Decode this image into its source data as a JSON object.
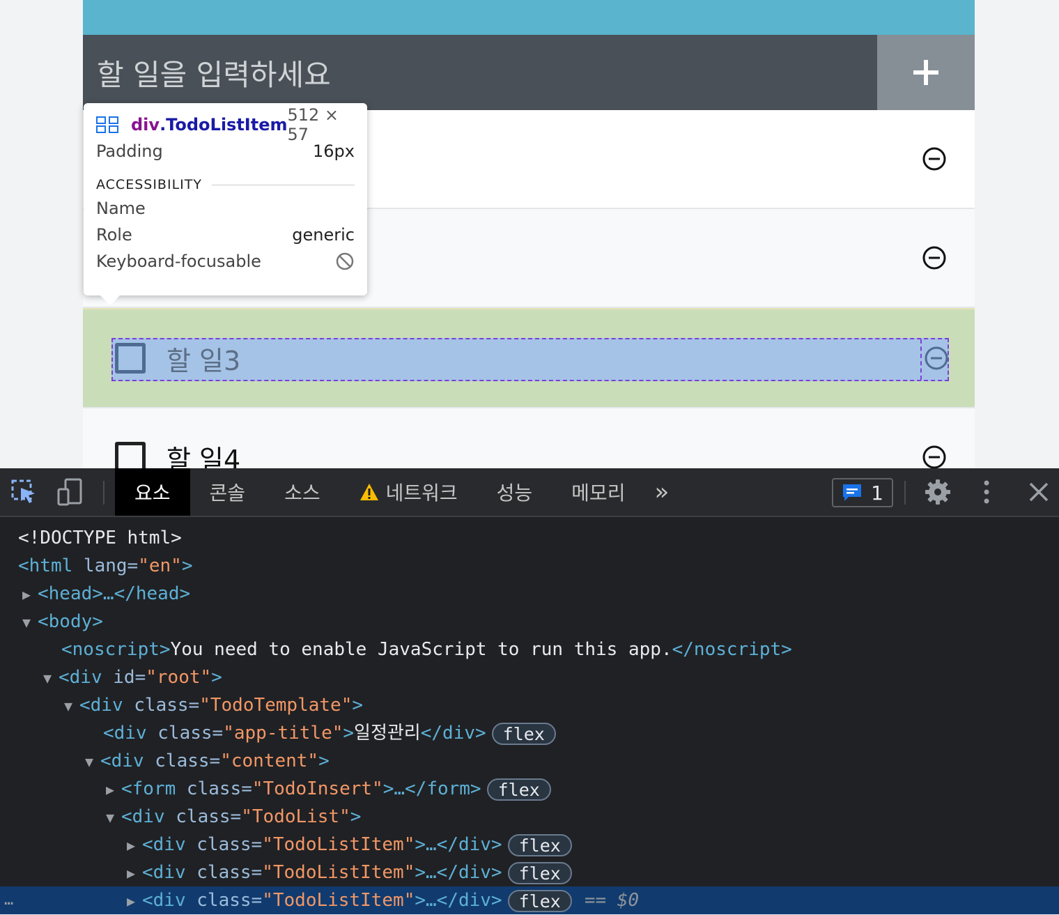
{
  "app": {
    "insert_placeholder": "할 일을 입력하세요",
    "todos": [
      {
        "text": ""
      },
      {
        "text": ""
      },
      {
        "text": "할 일3"
      },
      {
        "text": "할 일4"
      }
    ]
  },
  "tooltip": {
    "selector_tag": "div",
    "selector_class": ".TodoListItem",
    "size": "512 × 57",
    "padding_label": "Padding",
    "padding_value": "16px",
    "section": "ACCESSIBILITY",
    "name_label": "Name",
    "role_label": "Role",
    "role_value": "generic",
    "focusable_label": "Keyboard-focusable"
  },
  "devtools": {
    "tabs": [
      "요소",
      "콘솔",
      "소스",
      "네트워크",
      "성능",
      "메모리"
    ],
    "more_tabs": "»",
    "message_count": "1",
    "dom_lines": {
      "doctype": "<!DOCTYPE html>",
      "html_open": "<html",
      "html_attr": " lang=",
      "html_val": "\"en\"",
      "html_close": ">",
      "head": "<head>…</head>",
      "body": "<body>",
      "noscript_open": "<noscript>",
      "noscript_text": "You need to enable JavaScript to run this app.",
      "noscript_close": "</noscript>",
      "div_open": "<div",
      "id_attr": " id=",
      "root_val": "\"root\"",
      "class_attr": " class=",
      "todo_template": "\"TodoTemplate\"",
      "app_title": "\"app-title\"",
      "app_title_text": "일정관리",
      "div_close": "</div>",
      "content": "\"content\"",
      "form_open": "<form",
      "todo_insert": "\"TodoInsert\"",
      "form_close": ">…</form>",
      "todo_list": "\"TodoList\"",
      "todo_list_item": "\"TodoListItem\"",
      "collapsed_close": ">…</div>",
      "gt": ">",
      "flex": "flex",
      "eq": "== ",
      "dollar0": "$0",
      "ellipsis": "…"
    }
  }
}
